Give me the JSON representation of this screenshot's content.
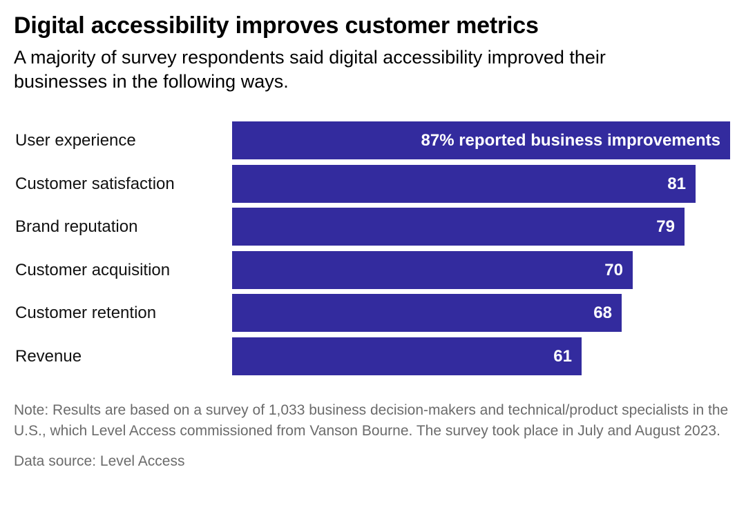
{
  "header": {
    "title": "Digital accessibility improves customer metrics",
    "subtitle": "A majority of survey respondents said digital accessibility improved their businesses in the following ways."
  },
  "footer": {
    "note": "Note: Results are based on a survey of 1,033 business decision-makers and technical/product specialists in the U.S., which Level Access commissioned from Vanson Bourne. The survey took place in July and August 2023.",
    "source": "Data source: Level Access"
  },
  "style": {
    "bar_color": "#332b9e",
    "value_label_color": "#ffffff",
    "category_label_color": "#111111",
    "footer_color": "#6b6b6b",
    "background": "#ffffff"
  },
  "chart_data": {
    "type": "bar",
    "orientation": "horizontal",
    "title": "Digital accessibility improves customer metrics",
    "subtitle": "A majority of survey respondents said digital accessibility improved their businesses in the following ways.",
    "xlabel": "",
    "ylabel": "",
    "xlim": [
      0,
      87
    ],
    "grid": false,
    "legend": false,
    "unit": "percent",
    "categories": [
      "User experience",
      "Customer satisfaction",
      "Brand reputation",
      "Customer acquisition",
      "Customer retention",
      "Revenue"
    ],
    "values": [
      87,
      81,
      79,
      70,
      68,
      61
    ],
    "data_labels": [
      "87% reported business improvements",
      "81",
      "79",
      "70",
      "68",
      "61"
    ],
    "series": [
      {
        "name": "Reported business improvements",
        "values": [
          87,
          81,
          79,
          70,
          68,
          61
        ]
      }
    ],
    "bars": [
      {
        "label": "User experience",
        "value": 87,
        "data_label": "87% reported business improvements"
      },
      {
        "label": "Customer satisfaction",
        "value": 81,
        "data_label": "81"
      },
      {
        "label": "Brand reputation",
        "value": 79,
        "data_label": "79"
      },
      {
        "label": "Customer acquisition",
        "value": 70,
        "data_label": "70"
      },
      {
        "label": "Customer retention",
        "value": 68,
        "data_label": "68"
      },
      {
        "label": "Revenue",
        "value": 61,
        "data_label": "61"
      }
    ],
    "note": "Note: Results are based on a survey of 1,033 business decision-makers and technical/product specialists in the U.S., which Level Access commissioned from Vanson Bourne. The survey took place in July and August 2023.",
    "source": "Data source: Level Access"
  }
}
